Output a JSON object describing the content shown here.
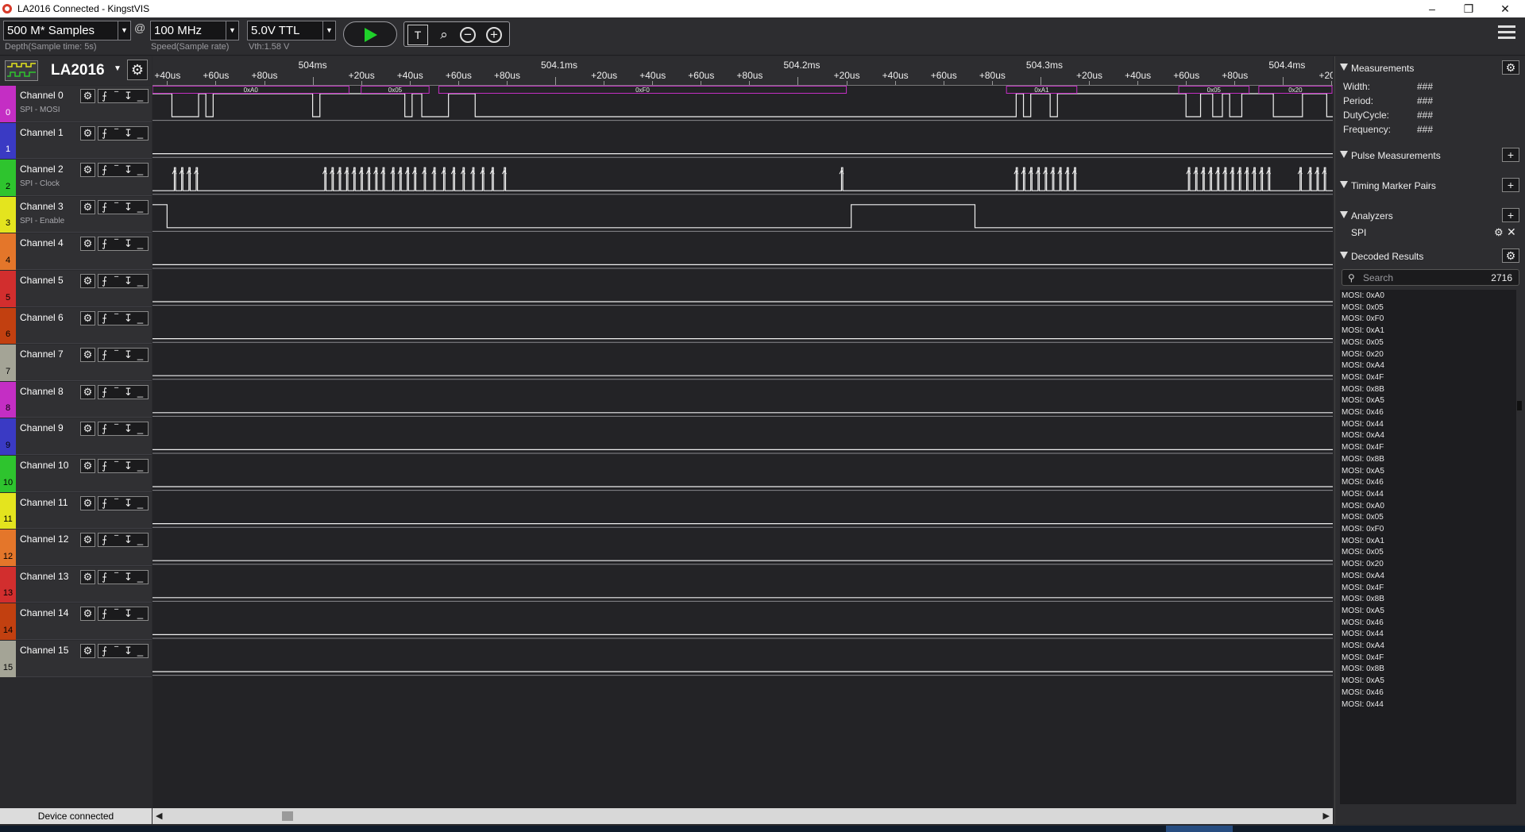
{
  "window": {
    "title": "LA2016 Connected - KingstVIS",
    "app_icon": "kingstvis-logo-icon",
    "min": "–",
    "max": "❐",
    "close": "✕"
  },
  "toolbar": {
    "depth": "500 M* Samples",
    "at": "@",
    "speed": "100 MHz",
    "voltage": "5.0V TTL",
    "depth_label": "Depth(Sample time: 5s)",
    "speed_label": "Speed(Sample rate)",
    "vth_label": "Vth:1.58 V",
    "dropdown_glyph": "▼",
    "run_icon": "play-icon",
    "tools": [
      {
        "name": "text-tool-icon",
        "glyph": "T"
      },
      {
        "name": "zoom-fit-icon",
        "glyph": "⌕"
      },
      {
        "name": "zoom-out-icon",
        "glyph": "−"
      },
      {
        "name": "zoom-in-icon",
        "glyph": "+"
      }
    ],
    "menu_icon": "hamburger-menu-icon"
  },
  "device": {
    "name": "LA2016",
    "dd": "▼",
    "gear": "⚙"
  },
  "time_axis": {
    "major": [
      {
        "t": 0,
        "label": "504ms"
      },
      {
        "t": 100,
        "label": "504.1ms"
      },
      {
        "t": 200,
        "label": "504.2ms"
      },
      {
        "t": 300,
        "label": "504.3ms"
      },
      {
        "t": 400,
        "label": "504.4ms"
      }
    ],
    "minor_offsets": [
      20,
      40,
      60,
      80
    ],
    "view_start_us": -66,
    "view_end_us": 420.5
  },
  "channel_ui": {
    "gear": "⚙",
    "trig": [
      "⨍",
      "‾",
      "↧",
      "_"
    ]
  },
  "channels": [
    {
      "idx": "0",
      "name": "Channel 0",
      "sub": "SPI - MOSI",
      "color": "#c42ec4",
      "textcolor": "#ffffff"
    },
    {
      "idx": "1",
      "name": "Channel 1",
      "sub": "",
      "color": "#3a3ac4",
      "textcolor": "#ffffff"
    },
    {
      "idx": "2",
      "name": "Channel 2",
      "sub": "SPI - Clock",
      "color": "#2ec42e",
      "textcolor": "#000000"
    },
    {
      "idx": "3",
      "name": "Channel 3",
      "sub": "SPI - Enable",
      "color": "#e4e41e",
      "textcolor": "#000000"
    },
    {
      "idx": "4",
      "name": "Channel 4",
      "sub": "",
      "color": "#e4762a",
      "textcolor": "#000000"
    },
    {
      "idx": "5",
      "name": "Channel 5",
      "sub": "",
      "color": "#d22e2e",
      "textcolor": "#000000"
    },
    {
      "idx": "6",
      "name": "Channel 6",
      "sub": "",
      "color": "#c24010",
      "textcolor": "#000000"
    },
    {
      "idx": "7",
      "name": "Channel 7",
      "sub": "",
      "color": "#a4a496",
      "textcolor": "#000000"
    },
    {
      "idx": "8",
      "name": "Channel 8",
      "sub": "",
      "color": "#c42ec4",
      "textcolor": "#000000"
    },
    {
      "idx": "9",
      "name": "Channel 9",
      "sub": "",
      "color": "#3a3ac4",
      "textcolor": "#000000"
    },
    {
      "idx": "10",
      "name": "Channel 10",
      "sub": "",
      "color": "#2ec42e",
      "textcolor": "#000000"
    },
    {
      "idx": "11",
      "name": "Channel 11",
      "sub": "",
      "color": "#e4e41e",
      "textcolor": "#000000"
    },
    {
      "idx": "12",
      "name": "Channel 12",
      "sub": "",
      "color": "#e4762a",
      "textcolor": "#000000"
    },
    {
      "idx": "13",
      "name": "Channel 13",
      "sub": "",
      "color": "#d22e2e",
      "textcolor": "#000000"
    },
    {
      "idx": "14",
      "name": "Channel 14",
      "sub": "",
      "color": "#c24010",
      "textcolor": "#000000"
    },
    {
      "idx": "15",
      "name": "Channel 15",
      "sub": "",
      "color": "#a4a496",
      "textcolor": "#000000"
    }
  ],
  "waveforms": {
    "decode_color": "#c42ec4",
    "decode": [
      {
        "t0": -66,
        "t1": 15,
        "label": "0xA0"
      },
      {
        "t0": 20,
        "t1": 48,
        "label": "0x05"
      },
      {
        "t0": 52,
        "t1": 220,
        "label": "0xF0"
      },
      {
        "t0": 286,
        "t1": 315,
        "label": "0xA1"
      },
      {
        "t0": 357,
        "t1": 386,
        "label": "0x05"
      },
      {
        "t0": 390,
        "t1": 420.5,
        "label": "0x20"
      }
    ],
    "ch0_edges": [
      -58,
      -47,
      -44,
      -41,
      0,
      3,
      38,
      41,
      45,
      56,
      67,
      290,
      293,
      296,
      304,
      307,
      360,
      366,
      371,
      375,
      378,
      383,
      396,
      408,
      418
    ],
    "ch0_start_high": true,
    "ch2_pulses": [
      -57,
      -54,
      -51,
      -48,
      5,
      8,
      11,
      14,
      17,
      20,
      23,
      26,
      29,
      33,
      36,
      39,
      42,
      46,
      50,
      54,
      58,
      62,
      66,
      70,
      74,
      79,
      218,
      290,
      293,
      296,
      299,
      302,
      305,
      308,
      311,
      314,
      361,
      364,
      367,
      370,
      373,
      376,
      379,
      382,
      385,
      388,
      391,
      394,
      407,
      411,
      414,
      417
    ],
    "ch3_edges": [
      -60,
      222,
      273
    ],
    "ch3_start_high": true
  },
  "status": {
    "text": "Device connected"
  },
  "hscroll": {
    "left": "◀",
    "right": "▶",
    "position": 0.11
  },
  "panel": {
    "measurements": {
      "title": "Measurements",
      "gear": "⚙",
      "rows": [
        {
          "label": "Width:",
          "value": "###"
        },
        {
          "label": "Period:",
          "value": "###"
        },
        {
          "label": "DutyCycle:",
          "value": "###"
        },
        {
          "label": "Frequency:",
          "value": "###"
        }
      ]
    },
    "pulse": {
      "title": "Pulse Measurements",
      "btn": "+"
    },
    "timing": {
      "title": "Timing Marker Pairs",
      "btn": "+"
    },
    "analyzers": {
      "title": "Analyzers",
      "btn": "+",
      "item": "SPI",
      "gear": "⚙",
      "close": "✕"
    },
    "decoded": {
      "title": "Decoded Results",
      "gear": "⚙",
      "search_icon": "🔍",
      "placeholder": "Search",
      "count": "2716",
      "items": [
        "MOSI: 0xA0",
        "MOSI: 0x05",
        "MOSI: 0xF0",
        "MOSI: 0xA1",
        "MOSI: 0x05",
        "MOSI: 0x20",
        "MOSI: 0xA4",
        "MOSI: 0x4F",
        "MOSI: 0x8B",
        "MOSI: 0xA5",
        "MOSI: 0x46",
        "MOSI: 0x44",
        "MOSI: 0xA4",
        "MOSI: 0x4F",
        "MOSI: 0x8B",
        "MOSI: 0xA5",
        "MOSI: 0x46",
        "MOSI: 0x44",
        "MOSI: 0xA0",
        "MOSI: 0x05",
        "MOSI: 0xF0",
        "MOSI: 0xA1",
        "MOSI: 0x05",
        "MOSI: 0x20",
        "MOSI: 0xA4",
        "MOSI: 0x4F",
        "MOSI: 0x8B",
        "MOSI: 0xA5",
        "MOSI: 0x46",
        "MOSI: 0x44",
        "MOSI: 0xA4",
        "MOSI: 0x4F",
        "MOSI: 0x8B",
        "MOSI: 0xA5",
        "MOSI: 0x46",
        "MOSI: 0x44"
      ]
    }
  }
}
